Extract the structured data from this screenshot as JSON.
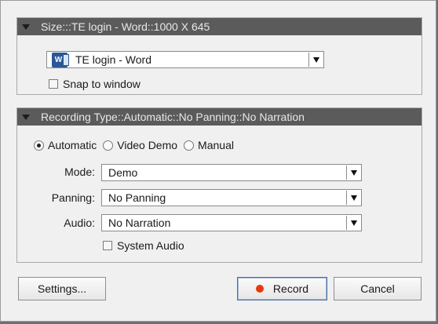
{
  "size_panel": {
    "header": "Size:::TE login - Word::1000 X 645",
    "window_select": {
      "value": "TE login - Word",
      "icon": "word-icon"
    },
    "snap_label": "Snap to window",
    "snap_checked": false
  },
  "recording_panel": {
    "header": "Recording Type::Automatic::No Panning::No Narration",
    "radios": [
      {
        "label": "Automatic",
        "selected": true
      },
      {
        "label": "Video Demo",
        "selected": false
      },
      {
        "label": "Manual",
        "selected": false
      }
    ],
    "mode": {
      "label": "Mode:",
      "value": "Demo"
    },
    "panning": {
      "label": "Panning:",
      "value": "No Panning"
    },
    "audio": {
      "label": "Audio:",
      "value": "No Narration"
    },
    "system_audio_label": "System Audio",
    "system_audio_checked": false
  },
  "buttons": {
    "settings": "Settings...",
    "record": "Record",
    "cancel": "Cancel"
  },
  "colors": {
    "header_bg": "#5b5b5b",
    "record_dot": "#e8380d",
    "dialog_bg": "#f0f0f0"
  }
}
